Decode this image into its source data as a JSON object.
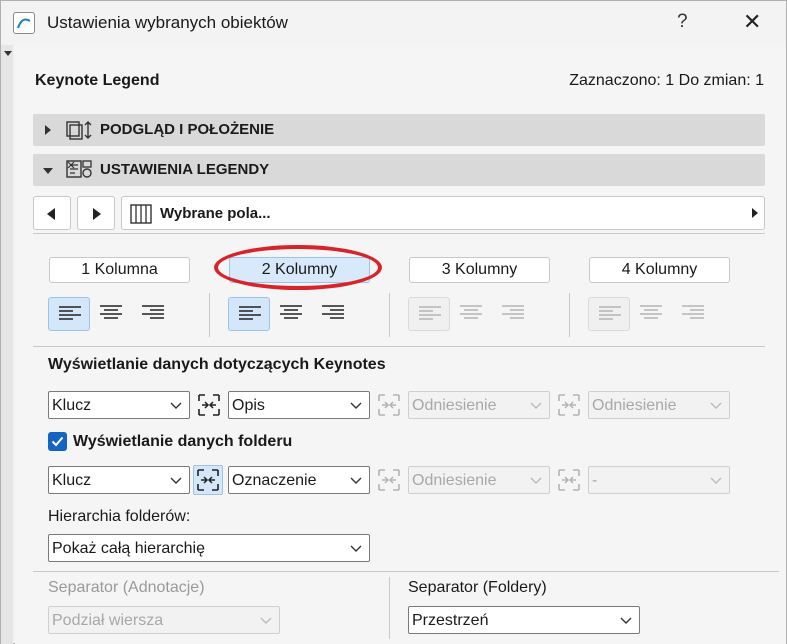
{
  "window": {
    "title": "Ustawienia wybranych obiektów",
    "help_label": "?",
    "close_label": "✕"
  },
  "object": {
    "name": "Keynote Legend",
    "status": "Zaznaczono: 1 Do zmian: 1"
  },
  "sections": {
    "preview_label": "PODGLĄD I POŁOŻENIE",
    "legend_label": "USTAWIENIA LEGENDY"
  },
  "navigator": {
    "field_label": "Wybrane pola..."
  },
  "columns": {
    "c1": "1 Kolumna",
    "c2": "2 Kolumny",
    "c3": "3 Kolumny",
    "c4": "4 Kolumny",
    "selected": "2 Kolumny"
  },
  "keynotes": {
    "heading": "Wyświetlanie danych dotyczących Keynotes",
    "dd1": "Klucz",
    "dd2": "Opis",
    "dd3": "Odniesienie",
    "dd4": "Odniesienie"
  },
  "folder": {
    "checkbox_label": "Wyświetlanie danych folderu",
    "checked": true,
    "dd1": "Klucz",
    "dd2": "Oznaczenie",
    "dd3": "Odniesienie",
    "dd4": "-"
  },
  "hierarchy": {
    "label": "Hierarchia folderów:",
    "value": "Pokaż całą hierarchię"
  },
  "separators": {
    "annotation_label": "Separator (Adnotacje)",
    "annotation_value": "Podział wiersza",
    "folders_label": "Separator (Foldery)",
    "folders_value": "Przestrzeń"
  },
  "colors": {
    "accent": "#1565c0",
    "highlight_ring": "#d8232a",
    "active_button": "#d7e9fb"
  }
}
